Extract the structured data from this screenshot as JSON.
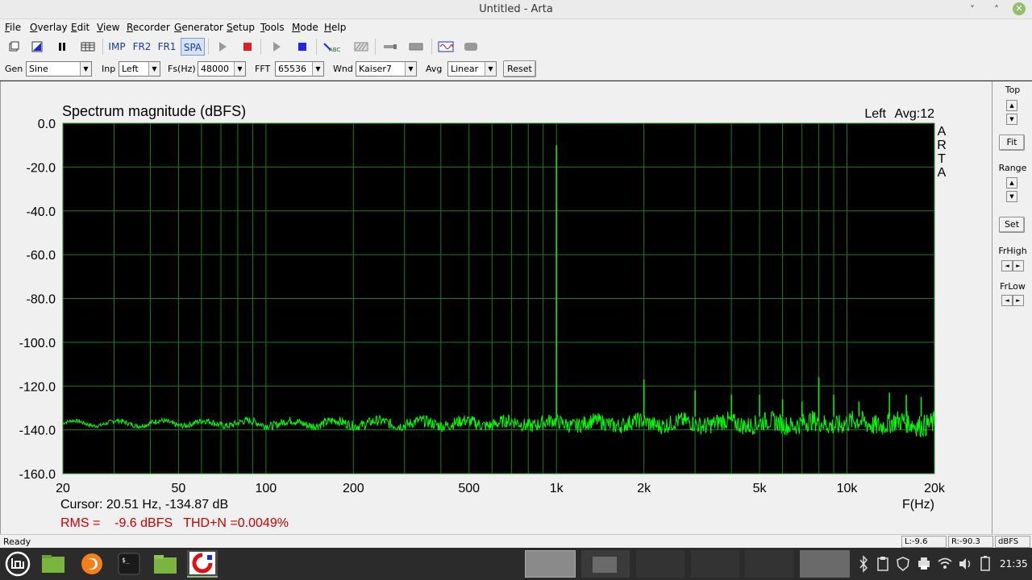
{
  "window": {
    "title": "Untitled - Arta",
    "minimize_glyph": "˅",
    "maximize_glyph": "˄",
    "close_glyph": "✕"
  },
  "menu": [
    {
      "pre": "",
      "u": "F",
      "post": "ile"
    },
    {
      "pre": "",
      "u": "O",
      "post": "verlay"
    },
    {
      "pre": "",
      "u": "E",
      "post": "dit"
    },
    {
      "pre": "",
      "u": "V",
      "post": "iew"
    },
    {
      "pre": "",
      "u": "R",
      "post": "ecorder"
    },
    {
      "pre": "",
      "u": "G",
      "post": "enerator"
    },
    {
      "pre": "",
      "u": "S",
      "post": "etup"
    },
    {
      "pre": "",
      "u": "T",
      "post": "ools"
    },
    {
      "pre": "",
      "u": "M",
      "post": "ode"
    },
    {
      "pre": "",
      "u": "H",
      "post": "elp"
    }
  ],
  "toolbar": {
    "imp": "IMP",
    "fr2": "FR2",
    "fr1": "FR1",
    "spa": "SPA",
    "abc": "ABC"
  },
  "controls": {
    "gen_label": "Gen",
    "gen_value": "Sine",
    "inp_label": "Inp",
    "inp_value": "Left",
    "fs_label": "Fs(Hz)",
    "fs_value": "48000",
    "fft_label": "FFT",
    "fft_value": "65536",
    "wnd_label": "Wnd",
    "wnd_value": "Kaiser7",
    "avg_label": "Avg",
    "avg_value": "Linear",
    "reset_label": "Reset"
  },
  "right_panel": {
    "top_label": "Top",
    "fit_label": "Fit",
    "range_label": "Range",
    "set_label": "Set",
    "frhigh_label": "FrHigh",
    "frlow_label": "FrLow",
    "up_glyph": "▲",
    "down_glyph": "▼",
    "left_glyph": "◄",
    "right_glyph": "►"
  },
  "status": {
    "ready": "Ready",
    "l_value": "L:-9.6",
    "r_value": "R:-90.3",
    "unit": "dBFS"
  },
  "taskbar": {
    "clock": "21:35",
    "terminal_glyph": "$_"
  },
  "chart_data": {
    "type": "line",
    "title": "Spectrum magnitude (dBFS)",
    "channel_label": "Left",
    "avg_label": "Avg:12",
    "brand_letters": [
      "A",
      "R",
      "T",
      "A"
    ],
    "x_scale": "log",
    "xlim": [
      20,
      20000
    ],
    "ylim": [
      -160,
      0
    ],
    "xlabel": "F(Hz)",
    "x_ticks": [
      {
        "value": 20,
        "label": "20"
      },
      {
        "value": 50,
        "label": "50"
      },
      {
        "value": 100,
        "label": "100"
      },
      {
        "value": 200,
        "label": "200"
      },
      {
        "value": 500,
        "label": "500"
      },
      {
        "value": 1000,
        "label": "1k"
      },
      {
        "value": 2000,
        "label": "2k"
      },
      {
        "value": 5000,
        "label": "5k"
      },
      {
        "value": 10000,
        "label": "10k"
      },
      {
        "value": 20000,
        "label": "20k"
      }
    ],
    "y_ticks": [
      "0.0",
      "-20.0",
      "-40.0",
      "-60.0",
      "-80.0",
      "-100.0",
      "-120.0",
      "-140.0",
      "-160.0"
    ],
    "grid": true,
    "background": "#000000",
    "line_color": "#00ff00",
    "grid_color": "#1e7a1e",
    "noise_floor_db": -137,
    "peaks": [
      {
        "freq": 1000,
        "db": -10
      },
      {
        "freq": 2000,
        "db": -117
      },
      {
        "freq": 3000,
        "db": -122
      },
      {
        "freq": 4000,
        "db": -124
      },
      {
        "freq": 5000,
        "db": -124
      },
      {
        "freq": 6000,
        "db": -126
      },
      {
        "freq": 7000,
        "db": -127
      },
      {
        "freq": 8000,
        "db": -116
      },
      {
        "freq": 9000,
        "db": -124
      },
      {
        "freq": 11000,
        "db": -127
      },
      {
        "freq": 14000,
        "db": -123
      },
      {
        "freq": 16000,
        "db": -124
      },
      {
        "freq": 18000,
        "db": -125
      }
    ],
    "cursor_text": "Cursor: 20.51 Hz, -134.87 dB",
    "rms_text": "RMS =    -9.6 dBFS   THD+N =0.0049%",
    "rms_color": "#cc0000"
  }
}
